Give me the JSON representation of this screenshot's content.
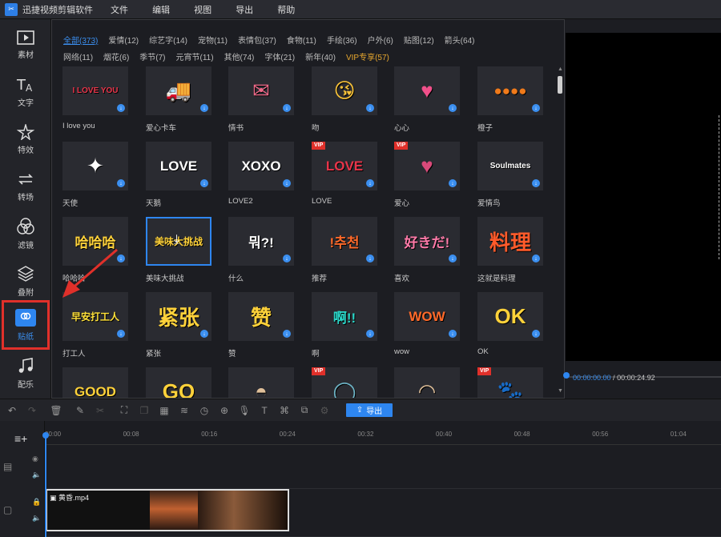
{
  "app": {
    "title": "迅捷视频剪辑软件"
  },
  "menu": [
    "文件",
    "编辑",
    "视图",
    "导出",
    "帮助"
  ],
  "sidebar": [
    {
      "label": "素材",
      "icon": "media-icon"
    },
    {
      "label": "文字",
      "icon": "text-icon"
    },
    {
      "label": "特效",
      "icon": "effects-icon"
    },
    {
      "label": "转场",
      "icon": "transition-icon"
    },
    {
      "label": "滤镜",
      "icon": "filter-icon"
    },
    {
      "label": "叠附",
      "icon": "overlay-icon"
    },
    {
      "label": "贴纸",
      "icon": "sticker-icon",
      "active": true
    },
    {
      "label": "配乐",
      "icon": "music-icon"
    }
  ],
  "categories": [
    {
      "label": "全部(373)",
      "active": true
    },
    {
      "label": "爱情(12)"
    },
    {
      "label": "综艺字(14)"
    },
    {
      "label": "宠物(11)"
    },
    {
      "label": "表情包(37)"
    },
    {
      "label": "食物(11)"
    },
    {
      "label": "手绘(36)"
    },
    {
      "label": "户外(6)"
    },
    {
      "label": "贴图(12)"
    },
    {
      "label": "箭头(64)"
    },
    {
      "label": "网络(11)"
    },
    {
      "label": "烟花(6)"
    },
    {
      "label": "季节(7)"
    },
    {
      "label": "元宵节(11)"
    },
    {
      "label": "其他(74)"
    },
    {
      "label": "字体(21)"
    },
    {
      "label": "新年(40)"
    },
    {
      "label": "VIP专享(57)",
      "vip": true
    }
  ],
  "stickers": [
    {
      "label": "I love you",
      "art": "I LOVE YOU",
      "color": "#e8354a"
    },
    {
      "label": "爱心卡车",
      "art": "🚚",
      "color": "#4aa0d8"
    },
    {
      "label": "情书",
      "art": "✉",
      "color": "#f06b8a"
    },
    {
      "label": "吻",
      "art": "😘",
      "color": "#f7c23a"
    },
    {
      "label": "心心",
      "art": "♥",
      "color": "#f0508a"
    },
    {
      "label": "橙子",
      "art": "●●●●",
      "color": "#f07a1a"
    },
    {
      "label": "天使",
      "art": "✦",
      "color": "#ffffff"
    },
    {
      "label": "天鹅",
      "art": "LOVE",
      "color": "#ffffff"
    },
    {
      "label": "LOVE2",
      "art": "XOXO",
      "color": "#ffffff"
    },
    {
      "label": "LOVE",
      "art": "LOVE",
      "color": "#e8354a",
      "vip": true
    },
    {
      "label": "爱心",
      "art": "♥",
      "color": "#d94a7a",
      "vip": true
    },
    {
      "label": "爱情鸟",
      "art": "Soulmates",
      "color": "#ffffff"
    },
    {
      "label": "哈哈哈",
      "art": "哈哈哈",
      "color": "#ffd23a"
    },
    {
      "label": "美味大挑战",
      "art": "美味大挑战",
      "color": "#ffd23a",
      "selected": true
    },
    {
      "label": "什么",
      "art": "뭐?!",
      "color": "#ffffff"
    },
    {
      "label": "推荐",
      "art": "!추천",
      "color": "#ff6a2a"
    },
    {
      "label": "喜欢",
      "art": "好きだ!",
      "color": "#ff7aa8"
    },
    {
      "label": "这就是料理",
      "art": "料理",
      "color": "#ff5a2a"
    },
    {
      "label": "打工人",
      "art": "早安打工人",
      "color": "#ffe13a"
    },
    {
      "label": "紧张",
      "art": "紧张",
      "color": "#ffd23a"
    },
    {
      "label": "赞",
      "art": "赞",
      "color": "#ffd23a"
    },
    {
      "label": "啊",
      "art": "啊!!",
      "color": "#2ad6c8"
    },
    {
      "label": "wow",
      "art": "WOW",
      "color": "#ff6a2a"
    },
    {
      "label": "OK",
      "art": "OK",
      "color": "#ffd23a"
    },
    {
      "label": "",
      "art": "GOOD",
      "color": "#ffd23a"
    },
    {
      "label": "",
      "art": "GO",
      "color": "#ffd23a"
    },
    {
      "label": "",
      "art": "◓",
      "color": "#e0c09a"
    },
    {
      "label": "",
      "art": "◯",
      "color": "#6fb6c8",
      "vip": true
    },
    {
      "label": "",
      "art": "◠",
      "color": "#e0c09a"
    },
    {
      "label": "",
      "art": "🐾",
      "color": "#e0a070",
      "vip": true
    }
  ],
  "preview": {
    "current": "00:00:00.00",
    "separator": " / ",
    "total": "00:00:24.92"
  },
  "toolbar": {
    "export_label": "导出"
  },
  "ruler": [
    "00:00",
    "00:08",
    "00:16",
    "00:24",
    "00:32",
    "00:40",
    "00:48",
    "00:56",
    "01:04"
  ],
  "clip": {
    "name": "黄昏.mp4"
  },
  "colors": {
    "accent": "#2e86f0",
    "highlight": "#e0302a",
    "vip": "#e6a72f"
  }
}
